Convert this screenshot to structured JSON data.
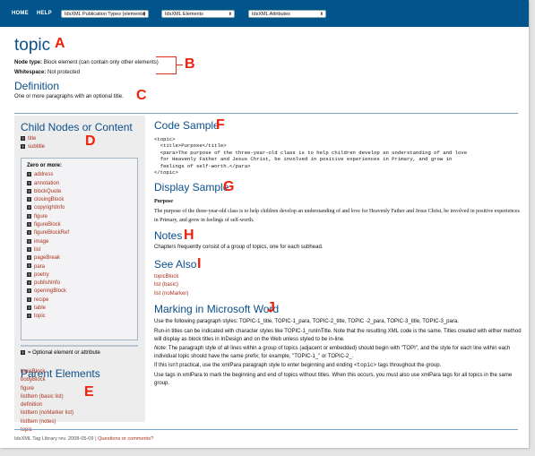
{
  "nav": {
    "home": "HOME",
    "help": "HELP",
    "selects": [
      {
        "value": "IdsXML Publication Types (elements)"
      },
      {
        "value": "IdsXML Elements"
      },
      {
        "value": "IdsXML Attributes"
      }
    ]
  },
  "header": {
    "title": "topic",
    "node_type_label": "Node type:",
    "node_type_value": "Block element (can contain only other elements)",
    "whitespace_label": "Whitespace:",
    "whitespace_value": "Not protected"
  },
  "markers": {
    "A": "A",
    "B": "B",
    "C": "C",
    "D": "D",
    "E": "E",
    "F": "F",
    "G": "G",
    "H": "H",
    "I": "I",
    "J": "J"
  },
  "definition": {
    "heading": "Definition",
    "text": "One or more paragraphs with an optional title."
  },
  "sidebar": {
    "child_heading": "Child Nodes or Content",
    "required_children": [
      "title",
      "subtitle"
    ],
    "zero_or_more_label": "Zero or more:",
    "zero_or_more": [
      "address",
      "annotation",
      "blockQuote",
      "closingBlock",
      "copyrightInfo",
      "figure",
      "figureBlock",
      "figureBlockRef",
      "image",
      "list",
      "pageBreak",
      "para",
      "poetry",
      "publishInfo",
      "openingBlock",
      "recipe",
      "table",
      "topic"
    ],
    "legend": "= Optional element or attribute",
    "optional_icon": "?",
    "parent_heading": "Parent Elements",
    "parents": [
      "topicBlock",
      "bodyBlock",
      "figure",
      "listItem (basic list)",
      "definition",
      "listItem (noMarker list)",
      "listItem (notes)",
      "topic"
    ]
  },
  "code_sample": {
    "heading": "Code Sample",
    "code": "<topic>\n  <title>Purpose</title>\n  <para>The purpose of the three-year-old class is to help children develop an understanding of and love\n  for Heavenly Father and Jesus Christ, be involved in positive experiences in Primary, and grow in\n  feelings of self-worth.</para>\n</topic>"
  },
  "display_sample": {
    "heading": "Display Sample",
    "title": "Purpose",
    "text": "The purpose of the three-year-old class is to help children develop an understanding of and love for Heavenly Father and Jesus Christ, be involved in positive experiences in Primary, and grow in feelings of self-worth."
  },
  "notes": {
    "heading": "Notes",
    "text": "Chapters frequently consist of a group of topics, one for each subhead."
  },
  "see_also": {
    "heading": "See Also",
    "links": [
      "topicBlock",
      "list (basic)",
      "list (noMarker)"
    ]
  },
  "marking": {
    "heading": "Marking in Microsoft Word",
    "p1": "Use the following paragraph styles: TOPIC-1_title, TOPIC-1_para, TOPIC-2_title, TOPIC -2_para, TOPIC-3_title, TOPIC-3_para.",
    "p2": "Run-in titles can be indicated with character styles like TOPIC-1_runInTitle. Note that the resulting XML code is the same. Titles created with either method will display as block titles in InDesign and on the Web unless styled to be in-line.",
    "p3_note": "Note:",
    "p3": " The paragraph style of all lines within a group of topics (adjacent or embedded) should begin with \"TOPI\", and the style for each line within each individual topic should have the same prefix; for example, \"TOPIC-1_\" or TOPIC-2_.",
    "p4_a": "If this isn't practical, use the xmlPara paragraph style to enter beginning and ending ",
    "p4_code": "<topic>",
    "p4_b": " tags throughout the group.",
    "p5": "Use tags in xmlPara to mark the beginning and end of topics without titles. When this occurs, you must also use xmlPara tags for all topics in the same group."
  },
  "footer": {
    "text": "IdsXML Tag Library rev. 2008-05-09 | ",
    "link": "Questions or comments?"
  }
}
